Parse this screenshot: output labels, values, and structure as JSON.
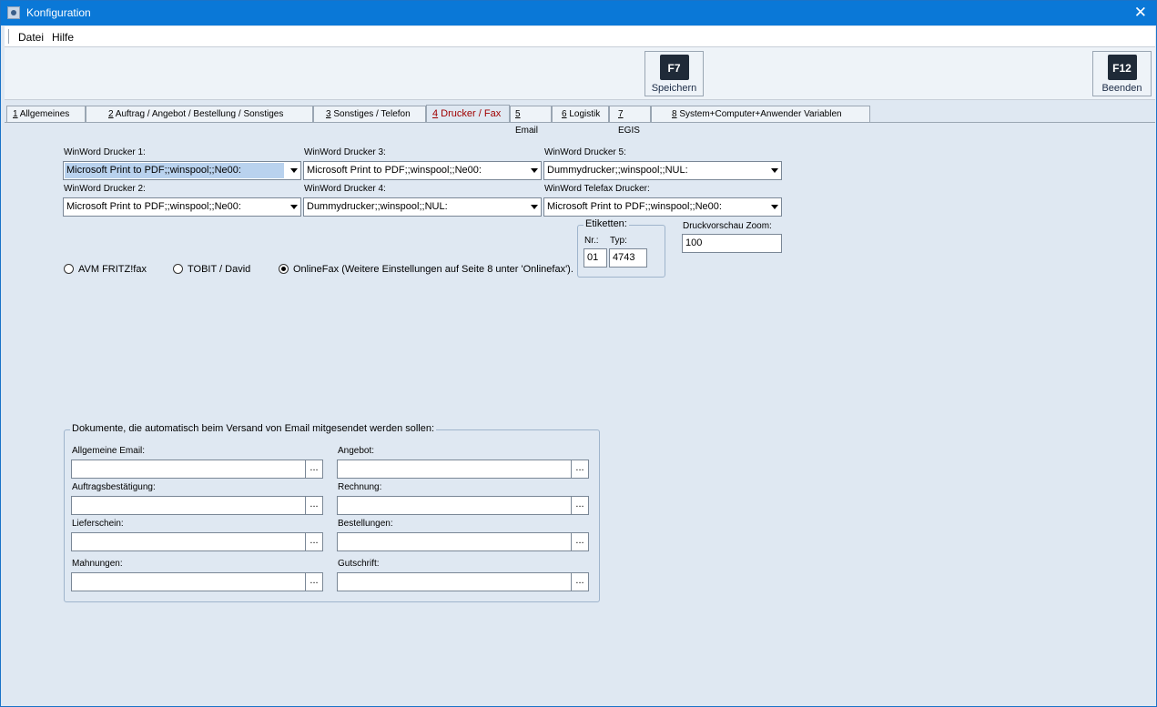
{
  "window": {
    "title": "Konfiguration",
    "close_glyph": "✕"
  },
  "menu": {
    "items": [
      "Datei",
      "Hilfe"
    ]
  },
  "toolbar": {
    "save": {
      "key": "F7",
      "label": "Speichern"
    },
    "exit": {
      "key": "F12",
      "label": "Beenden"
    }
  },
  "tabs": [
    {
      "num": "1",
      "label": " Allgemeines"
    },
    {
      "num": "2",
      "label": " Auftrag / Angebot / Bestellung / Sonstiges"
    },
    {
      "num": "3",
      "label": " Sonstiges / Telefon"
    },
    {
      "num": "4",
      "label": " Drucker / Fax"
    },
    {
      "num": "5",
      "label": " Email"
    },
    {
      "num": "6",
      "label": " Logistik"
    },
    {
      "num": "7",
      "label": " EGIS"
    },
    {
      "num": "8",
      "label": " System+Computer+Anwender Variablen"
    }
  ],
  "printers": {
    "d1": {
      "label": "WinWord Drucker 1:",
      "value": "Microsoft Print to PDF;;winspool;;Ne00:"
    },
    "d2": {
      "label": "WinWord Drucker 2:",
      "value": "Microsoft Print to PDF;;winspool;;Ne00:"
    },
    "d3": {
      "label": "WinWord Drucker 3:",
      "value": "Microsoft Print to PDF;;winspool;;Ne00:"
    },
    "d4": {
      "label": "WinWord Drucker 4:",
      "value": "Dummydrucker;;winspool;;NUL:"
    },
    "d5": {
      "label": "WinWord Drucker 5:",
      "value": "Dummydrucker;;winspool;;NUL:"
    },
    "fax": {
      "label": "WinWord Telefax Drucker:",
      "value": "Microsoft Print to PDF;;winspool;;Ne00:"
    }
  },
  "labels": {
    "title": "Etiketten:",
    "nr_label": "Nr.:",
    "nr_value": "01",
    "typ_label": "Typ:",
    "typ_value": "4743"
  },
  "zoom": {
    "label": "Druckvorschau Zoom:",
    "value": "100"
  },
  "fax_options": [
    {
      "label": "AVM FRITZ!fax",
      "selected": false
    },
    {
      "label": "TOBIT / David",
      "selected": false
    },
    {
      "label": "OnlineFax (Weitere Einstellungen auf Seite 8 unter 'Onlinefax').",
      "selected": true
    }
  ],
  "attachments": {
    "title": "Dokumente, die automatisch beim Versand von Email mitgesendet werden sollen:",
    "browse_label": "...",
    "fields": [
      {
        "label": "Allgemeine Email:",
        "value": ""
      },
      {
        "label": "Angebot:",
        "value": ""
      },
      {
        "label": "Auftragsbestätigung:",
        "value": ""
      },
      {
        "label": "Rechnung:",
        "value": ""
      },
      {
        "label": "Lieferschein:",
        "value": ""
      },
      {
        "label": "Bestellungen:",
        "value": ""
      },
      {
        "label": "Mahnungen:",
        "value": ""
      },
      {
        "label": "Gutschrift:",
        "value": ""
      }
    ]
  }
}
